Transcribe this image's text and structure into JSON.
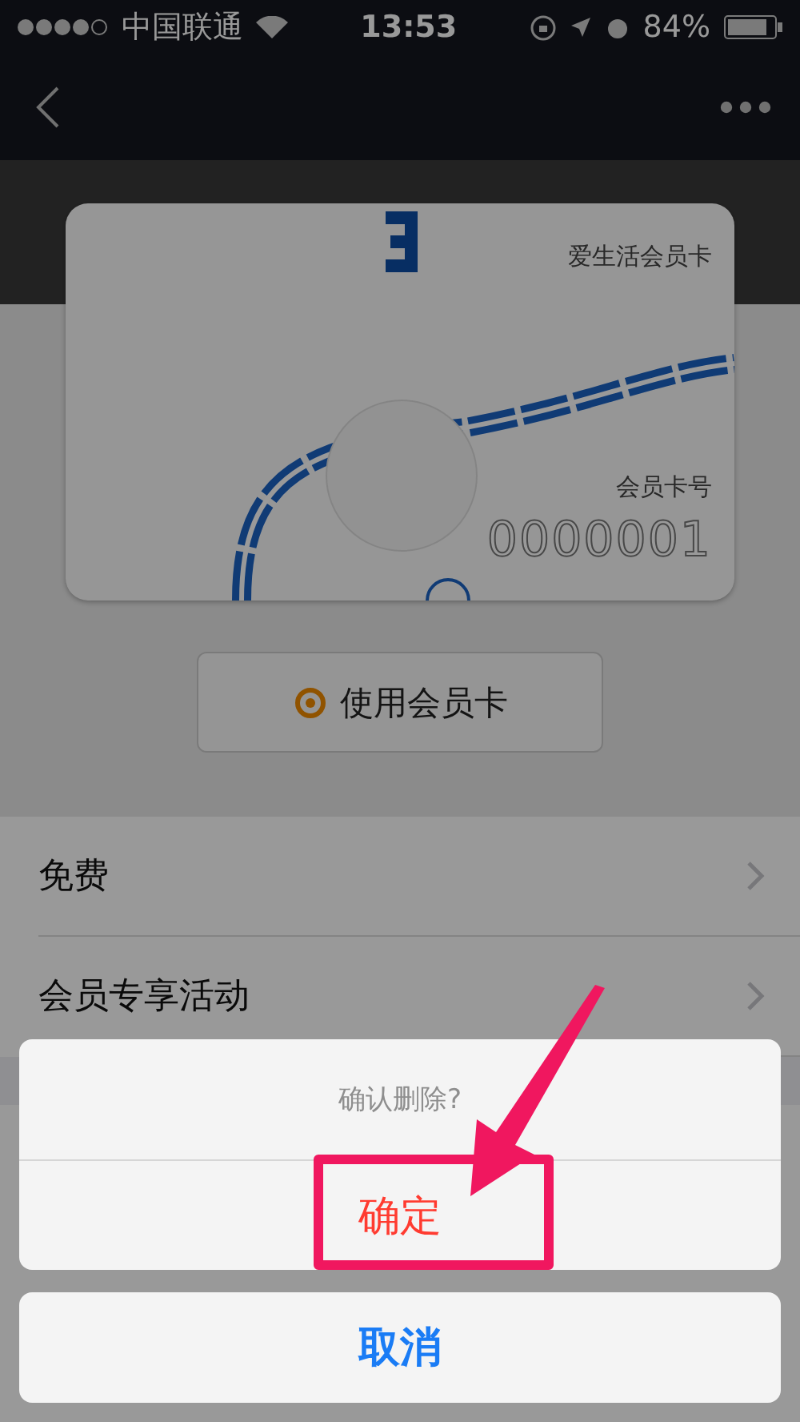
{
  "status_bar": {
    "carrier": "中国联通",
    "time": "13:53",
    "battery": "84%"
  },
  "card": {
    "name": "爱生活会员卡",
    "number_label": "会员卡号",
    "number": "0000001"
  },
  "use_button": {
    "label": "使用会员卡"
  },
  "menu": [
    {
      "label": "免费"
    },
    {
      "label": "会员专享活动"
    }
  ],
  "action_sheet": {
    "title": "确认删除?",
    "actions": [
      {
        "label": "确定",
        "kind": "destructive",
        "highlighted": true
      }
    ],
    "cancel": "取消"
  }
}
